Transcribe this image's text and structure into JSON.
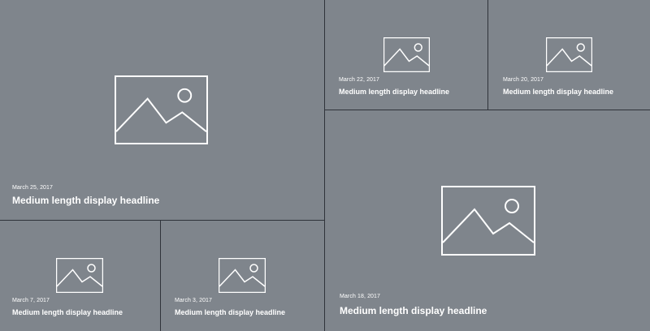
{
  "colors": {
    "tile_background": "#7f858c",
    "divider": "#2f333a",
    "text": "#ffffff"
  },
  "tiles": [
    {
      "date": "March 25, 2017",
      "headline": "Medium length display headline",
      "icon": "image-placeholder-icon"
    },
    {
      "date": "March 22, 2017",
      "headline": "Medium length display headline",
      "icon": "image-placeholder-icon"
    },
    {
      "date": "March 20, 2017",
      "headline": "Medium length display headline",
      "icon": "image-placeholder-icon"
    },
    {
      "date": "March 18, 2017",
      "headline": "Medium length display headline",
      "icon": "image-placeholder-icon"
    },
    {
      "date": "March 7, 2017",
      "headline": "Medium length display headline",
      "icon": "image-placeholder-icon"
    },
    {
      "date": "March 3, 2017",
      "headline": "Medium length display headline",
      "icon": "image-placeholder-icon"
    }
  ]
}
